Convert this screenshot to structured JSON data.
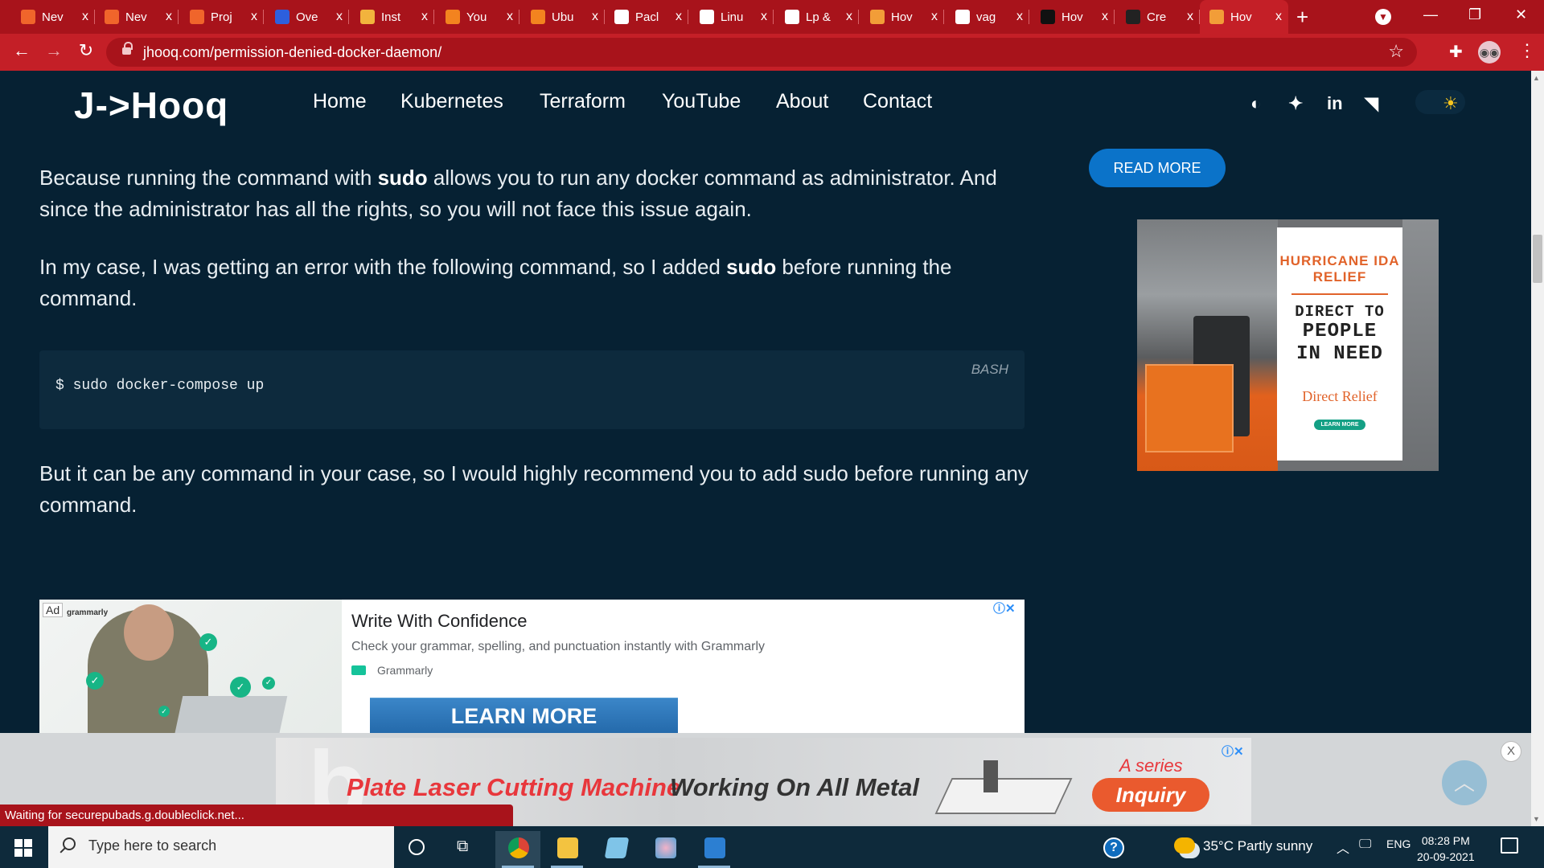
{
  "browser": {
    "tabs": [
      {
        "title": "Nev",
        "favicon": "gitlab-icon",
        "color": "#f0652b"
      },
      {
        "title": "Nev",
        "favicon": "gitlab-icon",
        "color": "#f0652b"
      },
      {
        "title": "Proj",
        "favicon": "gitlab-icon",
        "color": "#f0652b"
      },
      {
        "title": "Ove",
        "favicon": "shield-icon",
        "color": "#2d5fdd"
      },
      {
        "title": "Inst",
        "favicon": "box-icon",
        "color": "#f2b33d"
      },
      {
        "title": "You",
        "favicon": "cube-icon",
        "color": "#f3831f"
      },
      {
        "title": "Ubu",
        "favicon": "cube-icon",
        "color": "#f3831f"
      },
      {
        "title": "Pacl",
        "favicon": "google-icon",
        "color": "#ffffff"
      },
      {
        "title": "Linu",
        "favicon": "google-icon",
        "color": "#ffffff"
      },
      {
        "title": "Lp &",
        "favicon": "google-icon",
        "color": "#ffffff"
      },
      {
        "title": "Hov",
        "favicon": "arrow-icon",
        "color": "#f29d38"
      },
      {
        "title": "vag",
        "favicon": "google-icon",
        "color": "#ffffff"
      },
      {
        "title": "Hov",
        "favicon": "htg-icon",
        "color": "#111111"
      },
      {
        "title": "Cre",
        "favicon": "hex-icon",
        "color": "#222222"
      },
      {
        "title": "Hov",
        "favicon": "arrow-icon",
        "color": "#f29d38"
      }
    ],
    "tab_close": "x",
    "new_tab": "+",
    "url": "jhooq.com/permission-denied-docker-daemon/",
    "accent": "#c41f27"
  },
  "site": {
    "logo": "J->Hooq",
    "nav": [
      "Home",
      "Kubernetes",
      "Terraform",
      "YouTube",
      "About",
      "Contact"
    ],
    "social_icons": [
      "github-icon",
      "twitter-icon",
      "linkedin-icon",
      "rss-icon"
    ]
  },
  "article": {
    "p1_pre": "Because running the command with ",
    "p1_bold": "sudo",
    "p1_post": " allows you to run any docker command as administrator. And since the administrator has all the rights, so you will not face this issue again.",
    "p2_pre": "In my case, I was getting an error with the following command, so I added ",
    "p2_bold": "sudo",
    "p2_post": " before running the command.",
    "code": "$ sudo docker-compose up",
    "code_lang": "BASH",
    "p3": "But it can be any command in your case, so I would highly recommend you to add sudo before running any command."
  },
  "sidebar": {
    "read_more": "READ MORE",
    "ad_title": "HURRICANE IDA RELIEF",
    "ad_line1": "DIRECT TO",
    "ad_line2": "PEOPLE",
    "ad_line3": "IN NEED",
    "ad_brand": "Direct Relief",
    "ad_cta": "LEARN MORE"
  },
  "grammarly_ad": {
    "ad_label": "Ad",
    "brand_mark": "grammarly",
    "headline": "Write With Confidence",
    "body": "Check your grammar, spelling, and punctuation instantly with Grammarly",
    "sponsor": "Grammarly",
    "cta": "LEARN MORE"
  },
  "laser_ad": {
    "headline_red": "Plate Laser Cutting Machine",
    "headline_dark": "Working On All Metal",
    "series": "A series",
    "cta": "Inquiry",
    "close": "X"
  },
  "status": "Waiting for securepubads.g.doubleclick.net...",
  "taskbar": {
    "search_placeholder": "Type here to search",
    "weather": "35°C  Partly sunny",
    "language": "ENG",
    "time": "08:28 PM",
    "date": "20-09-2021"
  }
}
